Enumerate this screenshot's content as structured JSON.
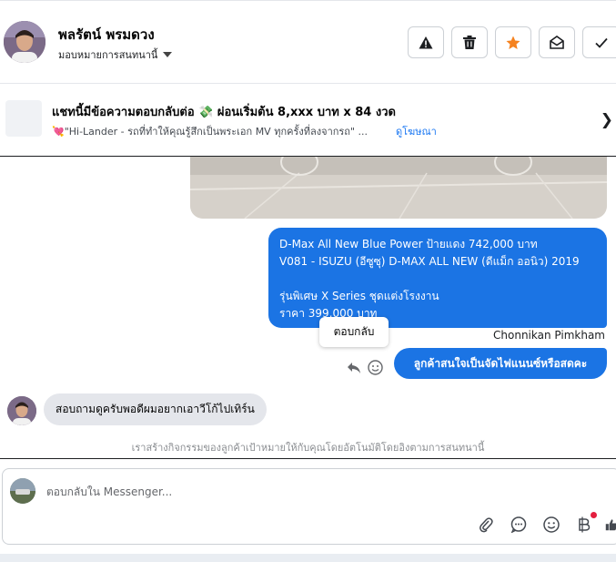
{
  "header": {
    "name": "พลรัตน์ พรมดวง",
    "assign_label": "มอบหมายการสนทนานี้",
    "actions": [
      {
        "name": "report-icon"
      },
      {
        "name": "trash-icon"
      },
      {
        "name": "star-icon",
        "color": "#f5821f"
      },
      {
        "name": "envelope-open-icon"
      },
      {
        "name": "check-icon"
      }
    ]
  },
  "ad": {
    "title": "แชทนี้มีข้อความตอบกลับต่อ 💸 ผ่อนเริ่มต้น 8,xxx บาท x 84 งวด",
    "subtitle": "💘\"Hi-Lander - รถที่ทำให้คุณรู้สึกเป็นพระเอก MV ทุกครั้งที่ลงจากรถ\" ...",
    "link": "ดูโฆษณา"
  },
  "messages": {
    "outgoing_1": [
      "D-Max All New Blue Power ป้ายแดง 742,000 บาท",
      "V081 - ISUZU (อีซูซุ) D-MAX ALL NEW (ดีแม็ก ออนิว) 2019",
      "",
      " รุ่นพิเศษ X Series ชุดแต่งโรงงาน",
      "ราคา 399,000 บาท"
    ],
    "sender_name": "Chonnikan Pimkham",
    "tooltip": "ตอบกลับ",
    "outgoing_2": "ลูกค้าสนใจเป็นจัดไฟแนนซ์หรือสดคะ",
    "incoming_1": "สอบถามดูครับพอดีผมอยากเอาวีโก้ไปเทิร์น",
    "system_note": "เราสร้างกิจกรรมของลูกค้าเป้าหมายให้กับคุณโดยอัตโนมัติโดยอิงตามการสนทนานี้"
  },
  "composer": {
    "placeholder": "ตอบกลับใน Messenger...",
    "tools": [
      "paperclip-icon",
      "chat-bubble-icon",
      "emoji-icon",
      "baht-icon",
      "like-icon"
    ]
  },
  "colors": {
    "accent": "#1b74e4",
    "incoming_bubble": "#e4e6eb",
    "link": "#1876f2"
  }
}
